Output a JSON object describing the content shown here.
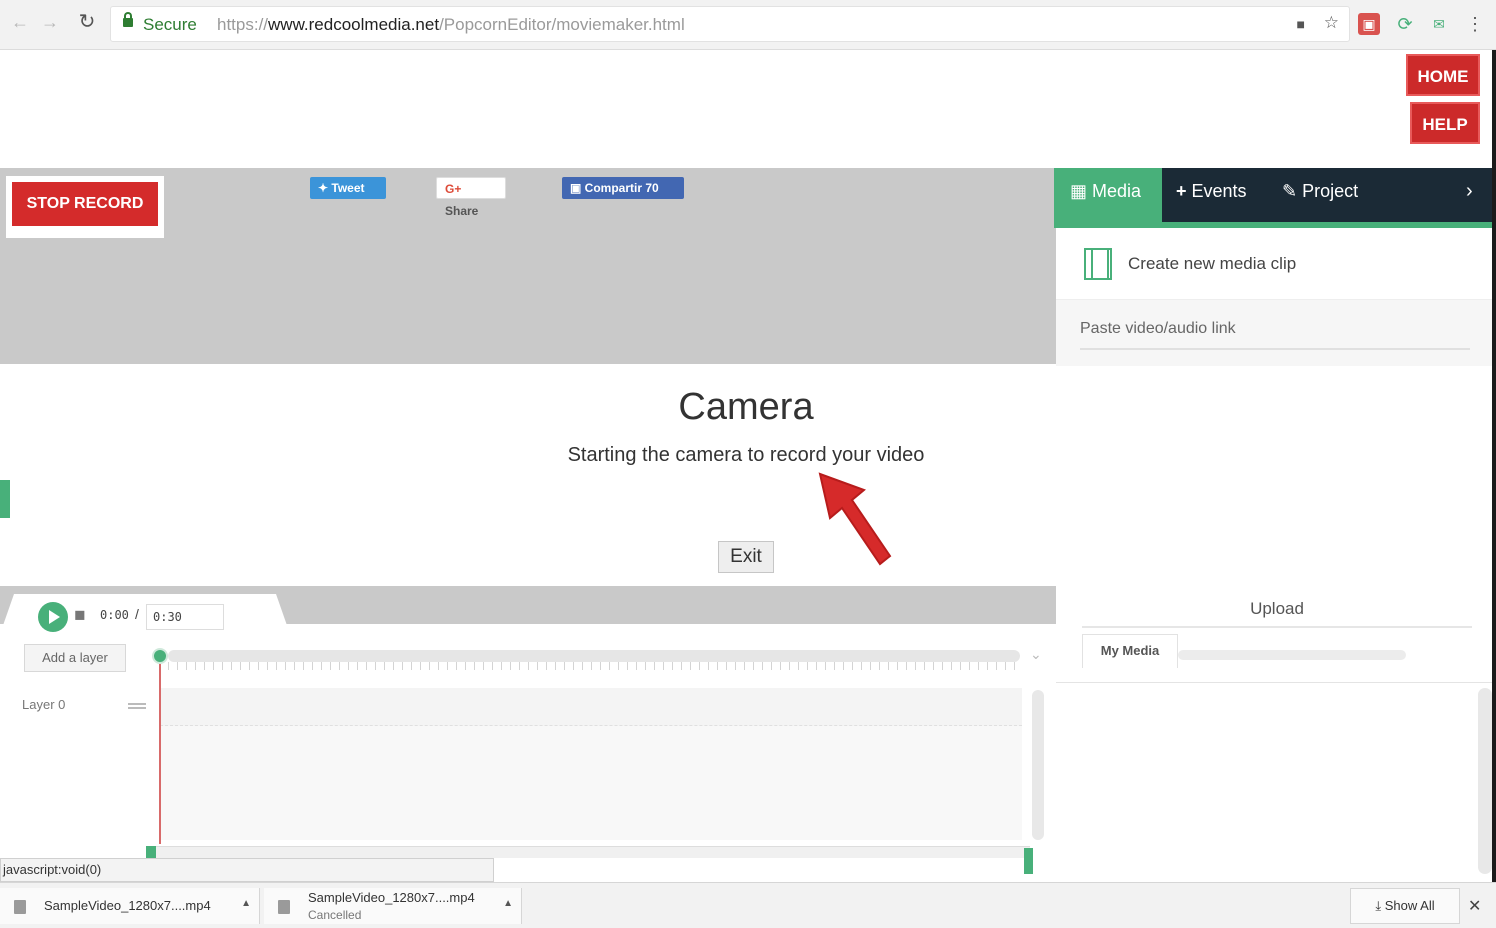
{
  "browser": {
    "secure_label": "Secure",
    "url_scheme": "https://",
    "url_domain": "www.redcoolmedia.net",
    "url_path": "/PopcornEditor/moviemaker.html"
  },
  "header": {
    "home_label": "HOME",
    "help_label": "HELP"
  },
  "preview": {
    "stop_record_label": "STOP RECORD",
    "tweet_label": "Tweet",
    "google_share_label": "Share",
    "facebook_share_label": "Compartir 70"
  },
  "panel": {
    "tabs": {
      "media": "Media",
      "events": "Events",
      "project": "Project"
    },
    "create_clip_label": "Create new media clip",
    "paste_link_label": "Paste video/audio link",
    "upload_label": "Upload",
    "my_media_label": "My Media"
  },
  "camera": {
    "title": "Camera",
    "subtitle": "Starting the camera to record your video",
    "exit_label": "Exit"
  },
  "timeline": {
    "current_time": "0:00",
    "separator": "/",
    "duration": "0:30",
    "add_layer_label": "Add a layer",
    "layer_name": "Layer 0"
  },
  "status_text": "javascript:void(0)",
  "downloads": {
    "items": [
      {
        "name": "SampleVideo_1280x7....mp4",
        "state": ""
      },
      {
        "name": "SampleVideo_1280x7....mp4",
        "state": "Cancelled"
      }
    ],
    "show_all_label": "Show All"
  },
  "colors": {
    "accent_green": "#48b07a",
    "action_red": "#d42b2b",
    "panel_dark": "#1b2a36"
  }
}
